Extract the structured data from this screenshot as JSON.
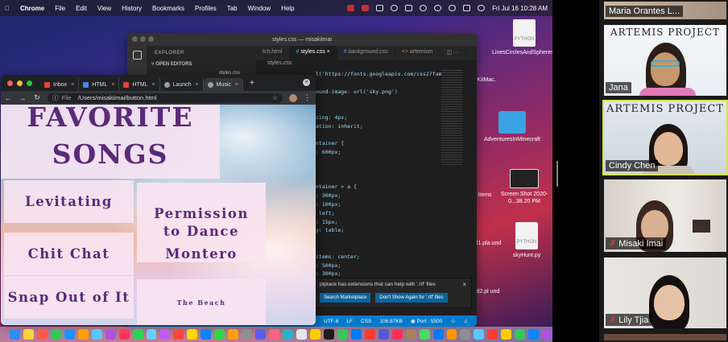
{
  "menubar": {
    "app": "Chrome",
    "items": [
      "File",
      "Edit",
      "View",
      "History",
      "Bookmarks",
      "Profiles",
      "Tab",
      "Window",
      "Help"
    ],
    "clock": "Fri Jul 16  10:28 AM"
  },
  "desktop": {
    "icons": [
      {
        "label": "LinesCirclesAndSpheres.py",
        "badge": "PYTHON"
      },
      {
        "label": "KitMac.",
        "badge": ""
      },
      {
        "label": "AdventuresInMinecraft",
        "badge": ""
      },
      {
        "label": "Items",
        "badge": ""
      },
      {
        "label": "Screen Shot 2020-0...38.20 PM",
        "badge": ""
      },
      {
        "label": "und1.pla und",
        "badge": ""
      },
      {
        "label": "skyHunt.py",
        "badge": "PYTHON"
      },
      {
        "label": "und2.pl und",
        "badge": ""
      }
    ]
  },
  "vscode": {
    "title": "styles.css — misakiimai",
    "explorer_header": "EXPLORER",
    "open_editors": "OPEN EDITORS",
    "open_editors_file": "styles.css",
    "tabs": [
      "tch.html",
      "styles.css",
      "background.css",
      "artemism"
    ],
    "breadcrumb": "styles.css",
    "code_lines": [
      "l('https://fonts.googleapis.com/css2?fami",
      "",
      "ound-image: url('sky.png')",
      "",
      "",
      "cing: 4px;",
      "ation: inherit;",
      "",
      "ntainer {",
      ": 600px;",
      "",
      "",
      "",
      "ntainer > a {",
      ": 300px;",
      ": 100px;",
      " left;",
      ": 15px;",
      "y: table;",
      "",
      "",
      "items: center;",
      ": 500px;",
      ": 300px;",
      ": none;"
    ],
    "notification": {
      "text": "ptplace has extensions that can help with '.rtf' files",
      "primary": "Search Marketplace",
      "secondary": "Don't Show Again for '.rtf' files"
    },
    "status": [
      "UTF-8",
      "LF",
      "CSS",
      "106.87KB",
      "Port : 5500"
    ]
  },
  "chrome": {
    "tabs": [
      {
        "label": "Inbox",
        "color": "#ea4335"
      },
      {
        "label": "HTML",
        "color": "#4285f4"
      },
      {
        "label": "HTML",
        "color": "#e8433e"
      },
      {
        "label": "Launch",
        "color": "#9aa0a6"
      },
      {
        "label": "Music",
        "color": "#9aa0a6"
      }
    ],
    "scheme": "File",
    "url": "/Users/misakiimai/button.html"
  },
  "webpage": {
    "title_line1": "FAVORITE",
    "title_line2": "SONGS",
    "songs": [
      "Levitating",
      "Permission to Dance",
      "Chit Chat",
      "Montero",
      "Snap Out of It",
      "The Beach"
    ]
  },
  "zoom": {
    "participants": [
      {
        "name": "Maria Orantes L...",
        "muted": false,
        "active": false
      },
      {
        "name": "Jana",
        "muted": false,
        "active": false,
        "banner": "ARTEMIS PROJECT"
      },
      {
        "name": "Cindy Chen",
        "muted": false,
        "active": true,
        "banner": "ARTEMIS PROJECT"
      },
      {
        "name": "Misaki Imai",
        "muted": true,
        "active": false
      },
      {
        "name": "Lily Tjia",
        "muted": true,
        "active": false
      }
    ]
  }
}
